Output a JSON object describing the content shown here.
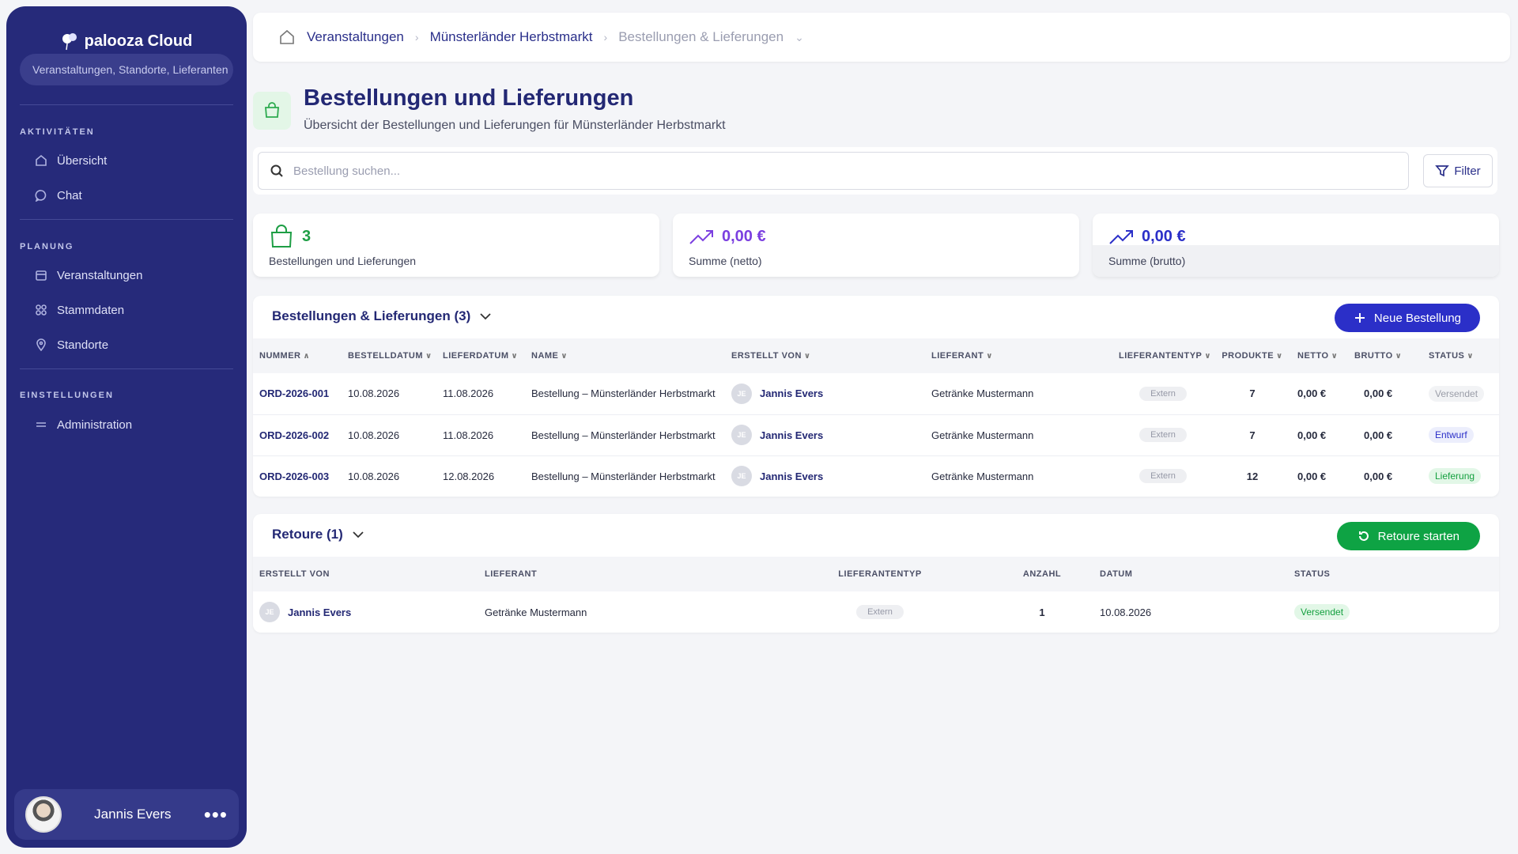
{
  "sidebar": {
    "brand": "palooza Cloud",
    "search_placeholder": "Veranstaltungen, Standorte, Lieferanten",
    "sections": [
      {
        "title": "AKTIVITÄTEN",
        "items": [
          {
            "label": "Übersicht",
            "icon": "home-icon"
          },
          {
            "label": "Chat",
            "icon": "chat-icon"
          }
        ]
      },
      {
        "title": "PLANUNG",
        "items": [
          {
            "label": "Veranstaltungen",
            "icon": "calendar-icon"
          },
          {
            "label": "Stammdaten",
            "icon": "grid-icon"
          },
          {
            "label": "Standorte",
            "icon": "location-icon"
          }
        ]
      },
      {
        "title": "EINSTELLUNGEN",
        "items": [
          {
            "label": "Administration",
            "icon": "sliders-icon"
          }
        ]
      }
    ],
    "user": {
      "name": "Jannis Evers"
    }
  },
  "breadcrumb": {
    "items": [
      "Veranstaltungen",
      "Münsterländer Herbstmarkt",
      "Bestellungen & Lieferungen"
    ]
  },
  "page": {
    "title": "Bestellungen und Lieferungen",
    "subtitle": "Übersicht der Bestellungen und Lieferungen für Münsterländer Herbstmarkt"
  },
  "search": {
    "placeholder": "Bestellung suchen...",
    "filter_label": "Filter"
  },
  "stats": [
    {
      "value": "3",
      "label": "Bestellungen und Lieferungen",
      "color": "#1e9e45"
    },
    {
      "value": "0,00 €",
      "label": "Summe (netto)",
      "color": "#7b3fe0"
    },
    {
      "value": "0,00 €",
      "label": "Summe (brutto)",
      "color": "#2b2fc8"
    }
  ],
  "orders": {
    "title": "Bestellungen & Lieferungen (3)",
    "new_button": "Neue Bestellung",
    "columns": [
      "NUMMER",
      "BESTELLDATUM",
      "LIEFERDATUM",
      "NAME",
      "ERSTELLT VON",
      "LIEFERANT",
      "LIEFERANTENTYP",
      "PRODUKTE",
      "NETTO",
      "BRUTTO",
      "STATUS"
    ],
    "rows": [
      {
        "nummer": "ORD-2026-001",
        "bestelldatum": "10.08.2026",
        "lieferdatum": "11.08.2026",
        "name": "Bestellung – Münsterländer Herbstmarkt",
        "initials": "JE",
        "erstellt": "Jannis Evers",
        "lieferant": "Getränke Mustermann",
        "typ": "Extern",
        "produkte": "7",
        "netto": "0,00 €",
        "brutto": "0,00 €",
        "status": "Versendet",
        "status_style": "grey"
      },
      {
        "nummer": "ORD-2026-002",
        "bestelldatum": "10.08.2026",
        "lieferdatum": "11.08.2026",
        "name": "Bestellung – Münsterländer Herbstmarkt",
        "initials": "JE",
        "erstellt": "Jannis Evers",
        "lieferant": "Getränke Mustermann",
        "typ": "Extern",
        "produkte": "7",
        "netto": "0,00 €",
        "brutto": "0,00 €",
        "status": "Entwurf",
        "status_style": "blue"
      },
      {
        "nummer": "ORD-2026-003",
        "bestelldatum": "10.08.2026",
        "lieferdatum": "12.08.2026",
        "name": "Bestellung – Münsterländer Herbstmarkt",
        "initials": "JE",
        "erstellt": "Jannis Evers",
        "lieferant": "Getränke Mustermann",
        "typ": "Extern",
        "produkte": "12",
        "netto": "0,00 €",
        "brutto": "0,00 €",
        "status": "Lieferung",
        "status_style": "green"
      }
    ]
  },
  "returns": {
    "title": "Retoure (1)",
    "start_button": "Retoure starten",
    "columns": [
      "ERSTELLT VON",
      "LIEFERANT",
      "LIEFERANTENTYP",
      "ANZAHL",
      "DATUM",
      "STATUS"
    ],
    "rows": [
      {
        "initials": "JE",
        "erstellt": "Jannis Evers",
        "lieferant": "Getränke Mustermann",
        "typ": "Extern",
        "anzahl": "1",
        "datum": "10.08.2026",
        "status": "Versendet",
        "status_style": "green"
      }
    ]
  }
}
